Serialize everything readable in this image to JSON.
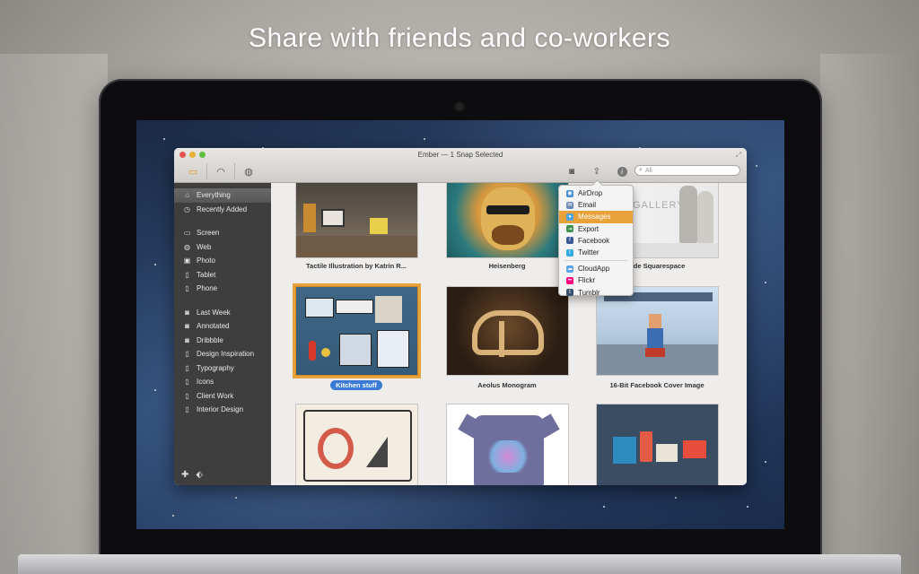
{
  "headline": "Share with friends and co-workers",
  "window": {
    "title": "Ember — 1 Snap Selected"
  },
  "search": {
    "placeholder": "All"
  },
  "sidebar": {
    "group1": [
      {
        "label": "Everything",
        "icon": "home-icon",
        "selected": true
      },
      {
        "label": "Recently Added",
        "icon": "clock-icon"
      }
    ],
    "group2": [
      {
        "label": "Screen",
        "icon": "screen-icon"
      },
      {
        "label": "Web",
        "icon": "globe-icon"
      },
      {
        "label": "Photo",
        "icon": "photo-icon"
      },
      {
        "label": "Tablet",
        "icon": "tablet-icon"
      },
      {
        "label": "Phone",
        "icon": "phone-icon"
      }
    ],
    "group3": [
      {
        "label": "Last Week",
        "icon": "smart-collection-icon"
      },
      {
        "label": "Annotated",
        "icon": "smart-collection-icon"
      },
      {
        "label": "Dribbble",
        "icon": "smart-collection-icon"
      },
      {
        "label": "Design Inspiration",
        "icon": "collection-icon"
      },
      {
        "label": "Typography",
        "icon": "collection-icon"
      },
      {
        "label": "Icons",
        "icon": "collection-icon"
      },
      {
        "label": "Client Work",
        "icon": "collection-icon"
      },
      {
        "label": "Interior Design",
        "icon": "collection-icon"
      }
    ]
  },
  "tiles": [
    {
      "caption": "Tactile Illustration by Katrin R..."
    },
    {
      "caption": "Heisenberg"
    },
    {
      "caption": "r de Squarespace"
    },
    {
      "caption": "Kitchen stuff",
      "selected": true
    },
    {
      "caption": "Aeolus Monogram"
    },
    {
      "caption": "16-Bit Facebook Cover Image"
    },
    {
      "caption": ""
    },
    {
      "caption": ""
    },
    {
      "caption": ""
    }
  ],
  "gallery_text": "GALLERY",
  "share_menu": {
    "items": [
      {
        "label": "AirDrop",
        "icon": "airdrop-icon",
        "color": "#4a90d9"
      },
      {
        "label": "Email",
        "icon": "email-icon",
        "color": "#6b8bb5"
      },
      {
        "label": "Messages",
        "icon": "messages-icon",
        "color": "#4aa3e0",
        "highlighted": true
      },
      {
        "label": "Export",
        "icon": "export-icon",
        "color": "#3d8f4a"
      },
      {
        "label": "Facebook",
        "icon": "facebook-icon",
        "color": "#3b5998"
      },
      {
        "label": "Twitter",
        "icon": "twitter-icon",
        "color": "#2fa9e0"
      }
    ],
    "items2": [
      {
        "label": "CloudApp",
        "icon": "cloudapp-icon",
        "color": "#5aa4e6"
      },
      {
        "label": "Flickr",
        "icon": "flickr-icon",
        "color": "#ff0084"
      },
      {
        "label": "Tumblr",
        "icon": "tumblr-icon",
        "color": "#34526f"
      }
    ]
  },
  "colors": {
    "accent": "#e6a23c",
    "selection": "#3a7bd5",
    "sidebar": "#3f3e3f"
  }
}
